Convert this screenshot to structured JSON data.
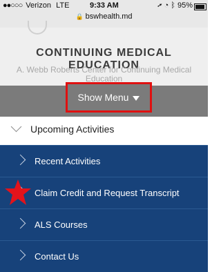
{
  "status_bar": {
    "carrier": "Verizon",
    "network": "LTE",
    "time": "9:33 AM",
    "battery": "95%",
    "url": "bswhealth.md"
  },
  "header": {
    "title": "CONTINUING MEDICAL EDUCATION",
    "subtitle": "A. Webb Roberts Center for Continuing Medical Education"
  },
  "menu": {
    "show_menu_label": "Show Menu"
  },
  "nav": {
    "upcoming": "Upcoming Activities",
    "items": [
      {
        "label": "Recent Activities"
      },
      {
        "label": "Claim Credit and Request Transcript"
      },
      {
        "label": "ALS Courses"
      },
      {
        "label": "Contact Us"
      }
    ]
  },
  "colors": {
    "nav_bg": "#17427a",
    "menubar_bg": "#7b7b7b",
    "highlight": "#e01010"
  }
}
